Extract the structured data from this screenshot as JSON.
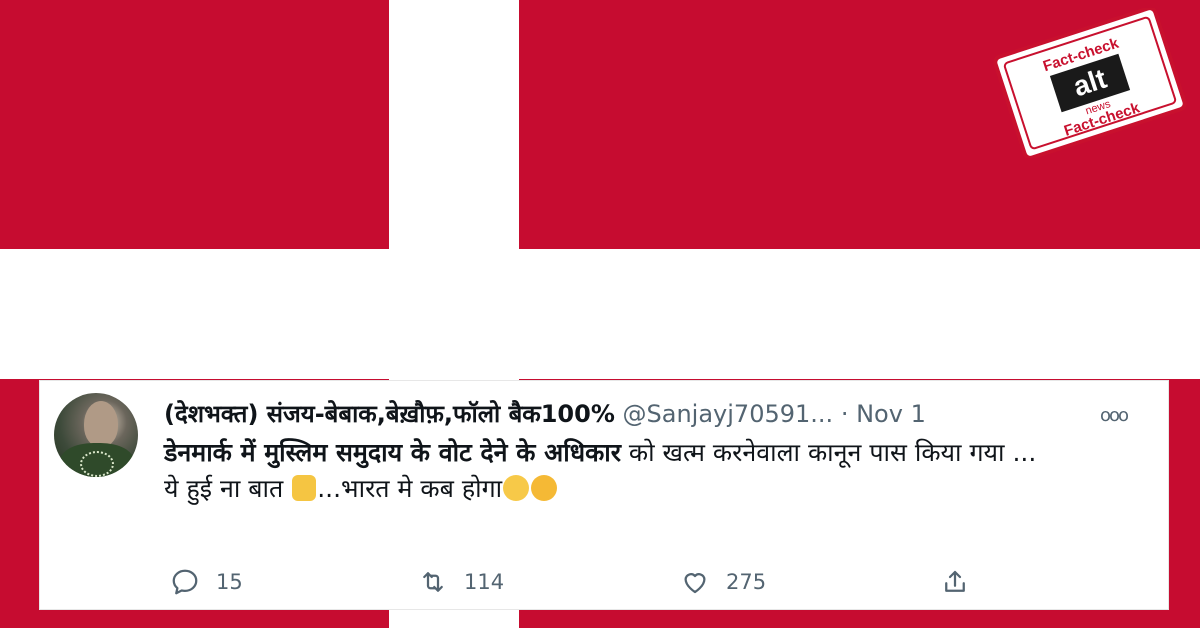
{
  "colors": {
    "flag_red": "#c60c30",
    "text_primary": "#0f1419",
    "text_secondary": "#536471"
  },
  "stamp": {
    "top_text": "Fact-check",
    "bottom_text": "Fact-check",
    "logo_main": "alt",
    "logo_sub": "news"
  },
  "tweet": {
    "avatar_icon": "profile-photo",
    "display_name": "(देशभक्त) संजय-बेबाक,बेख़ौफ़,फॉलो बैक100%",
    "handle": "@Sanjayj70591...",
    "separator": "·",
    "date": "Nov 1",
    "more_icon": "ooo",
    "body_bold": "डेनमार्क में मुस्लिम समुदाय के वोट देने के अधिकार",
    "body_rest": " को खत्म करनेवाला कानून पास किया गया ...",
    "body_line2_start": "ये हुई ना बात ",
    "body_line2_mid": "...भारत मे कब होगा",
    "emojis": [
      "thumbs-up",
      "face-with-rolling-eyes",
      "thinking-face"
    ],
    "stats": {
      "replies": "15",
      "retweets": "114",
      "likes": "275"
    }
  }
}
